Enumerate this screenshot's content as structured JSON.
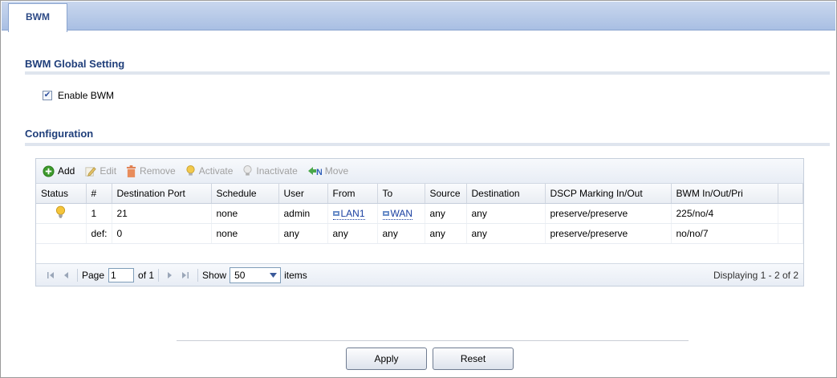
{
  "tab": {
    "label": "BWM"
  },
  "global_setting": {
    "title": "BWM Global Setting",
    "enable_label": "Enable BWM",
    "enable_checked": true
  },
  "configuration": {
    "title": "Configuration",
    "toolbar": {
      "add": "Add",
      "edit": "Edit",
      "remove": "Remove",
      "activate": "Activate",
      "inactivate": "Inactivate",
      "move": "Move"
    },
    "columns": [
      "Status",
      "#",
      "Destination Port",
      "Schedule",
      "User",
      "From",
      "To",
      "Source",
      "Destination",
      "DSCP Marking In/Out",
      "BWM In/Out/Pri"
    ],
    "rows": [
      {
        "status_icon": "lightbulb-on-icon",
        "num": "1",
        "dest_port": "21",
        "schedule": "none",
        "user": "admin",
        "from": "LAN1",
        "to": "WAN",
        "source": "any",
        "destination": "any",
        "dscp": "preserve/preserve",
        "bwm": "225/no/4"
      },
      {
        "status_icon": "",
        "num": "def:",
        "dest_port": "0",
        "schedule": "none",
        "user": "any",
        "from": "any",
        "to": "any",
        "source": "any",
        "destination": "any",
        "dscp": "preserve/preserve",
        "bwm": "no/no/7"
      }
    ],
    "pager": {
      "page_label": "Page",
      "page_value": "1",
      "of_label": "of 1",
      "show_label": "Show",
      "show_value": "50",
      "items_label": "items",
      "displaying": "Displaying 1 - 2 of 2"
    }
  },
  "buttons": {
    "apply": "Apply",
    "reset": "Reset"
  },
  "colors": {
    "accent": "#1f3e7a",
    "tab_bar": "#a9bfe3",
    "link": "#1a3fa0"
  }
}
